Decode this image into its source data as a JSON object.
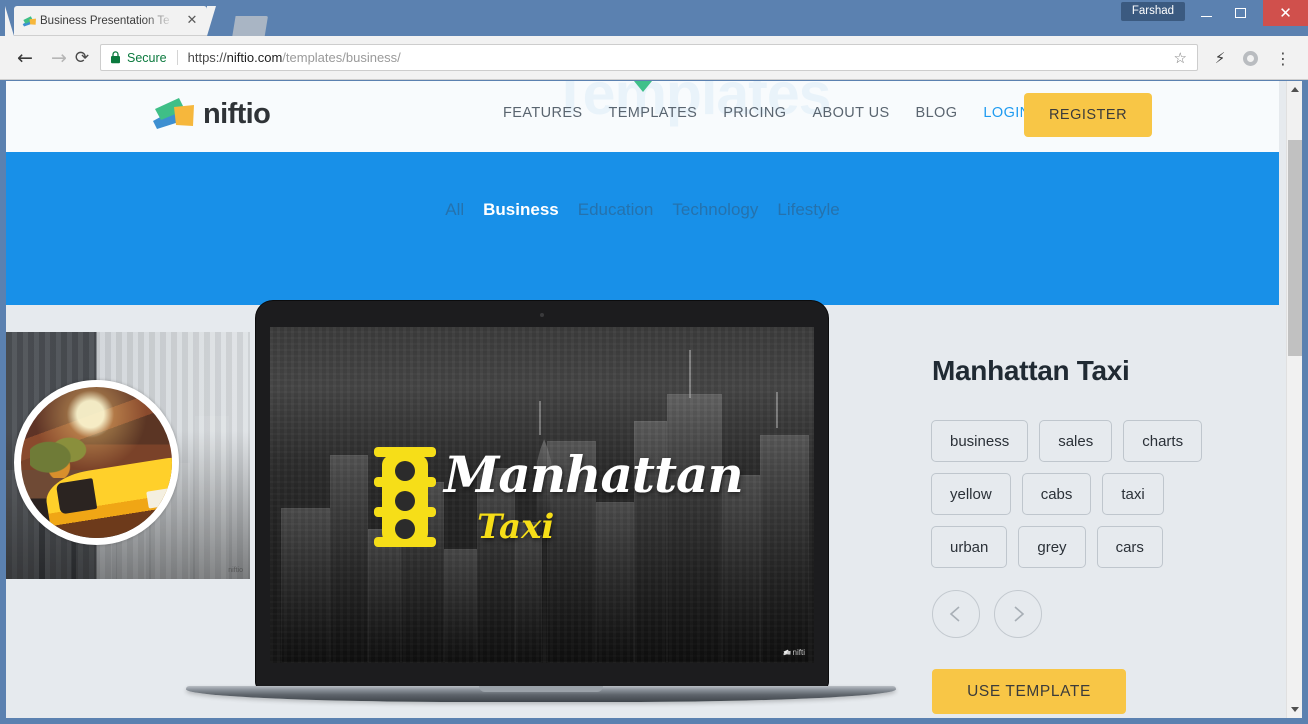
{
  "browser": {
    "tab": {
      "title": "Business Presentation Te",
      "close_label": "✕",
      "favicon_name": "niftio-favicon"
    },
    "newtab_label": "",
    "profile_name": "Farshad",
    "window_controls": {
      "minimize": "",
      "maximize": "",
      "close": "✕"
    },
    "nav": {
      "back": "←",
      "forward": "→",
      "reload": "⟳"
    },
    "omnibox": {
      "security_label": "Secure",
      "url_scheme": "https://",
      "url_host": "niftio.com",
      "url_path": "/templates/business/",
      "bookmark_star": "☆"
    },
    "toolbar_icons": {
      "bolt": "⚡",
      "extension": "",
      "menu": "⋮"
    }
  },
  "site": {
    "watermark": "Templates",
    "logo_text": "niftio",
    "nav_items": [
      {
        "label": "FEATURES",
        "state": "default"
      },
      {
        "label": "TEMPLATES",
        "state": "current"
      },
      {
        "label": "PRICING",
        "state": "default"
      },
      {
        "label": "ABOUT US",
        "state": "default"
      },
      {
        "label": "BLOG",
        "state": "default"
      },
      {
        "label": "LOGIN",
        "state": "link"
      }
    ],
    "register_label": "REGISTER",
    "accent_blue": "#1890e8",
    "accent_yellow": "#f8c646",
    "accent_green": "#3fc08a"
  },
  "filters": {
    "items": [
      {
        "label": "All",
        "active": false
      },
      {
        "label": "Business",
        "active": true
      },
      {
        "label": "Education",
        "active": false
      },
      {
        "label": "Technology",
        "active": false
      },
      {
        "label": "Lifestyle",
        "active": false
      }
    ]
  },
  "preview": {
    "slide_title": "Manhattan",
    "slide_subtitle": "Taxi",
    "slide_watermark": "nifti",
    "prev_thumb_watermark": "niftio"
  },
  "template": {
    "name": "Manhattan Taxi",
    "tags": [
      "business",
      "sales",
      "charts",
      "yellow",
      "cabs",
      "taxi",
      "urban",
      "grey",
      "cars"
    ],
    "prev_label": "‹",
    "next_label": "›",
    "use_template_label": "USE TEMPLATE"
  }
}
